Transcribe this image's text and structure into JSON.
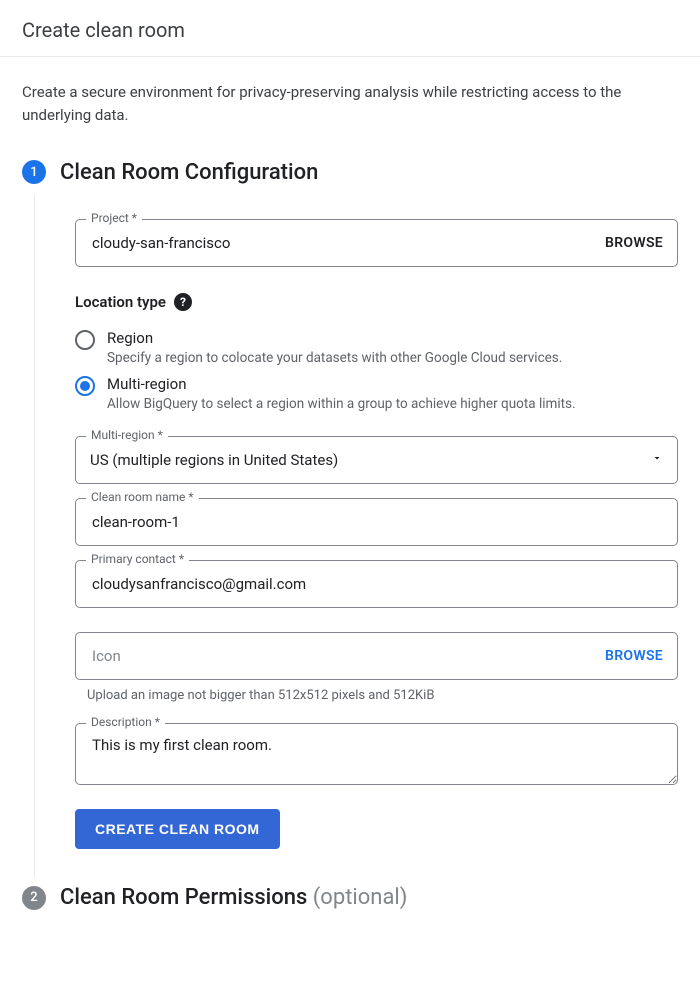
{
  "header": {
    "title": "Create clean room"
  },
  "description": "Create a secure environment for privacy-preserving analysis while restricting access to the underlying data.",
  "step1": {
    "number": "1",
    "title": "Clean Room Configuration",
    "project": {
      "label": "Project *",
      "value": "cloudy-san-francisco",
      "browse": "BROWSE"
    },
    "location_type": {
      "label": "Location type",
      "options": [
        {
          "title": "Region",
          "desc": "Specify a region to colocate your datasets with other Google Cloud services.",
          "selected": false
        },
        {
          "title": "Multi-region",
          "desc": "Allow BigQuery to select a region within a group to achieve higher quota limits.",
          "selected": true
        }
      ]
    },
    "multiregion": {
      "label": "Multi-region *",
      "value": "US (multiple regions in United States)"
    },
    "cleanroom_name": {
      "label": "Clean room name *",
      "value": "clean-room-1"
    },
    "primary_contact": {
      "label": "Primary contact *",
      "value": "cloudysanfrancisco@gmail.com"
    },
    "icon": {
      "placeholder": "Icon",
      "browse": "BROWSE",
      "helper": "Upload an image not bigger than 512x512 pixels and 512KiB"
    },
    "descfield": {
      "label": "Description *",
      "value": "This is my first clean room."
    },
    "submit": "CREATE CLEAN ROOM"
  },
  "step2": {
    "number": "2",
    "title": "Clean Room Permissions",
    "optional": "(optional)"
  }
}
